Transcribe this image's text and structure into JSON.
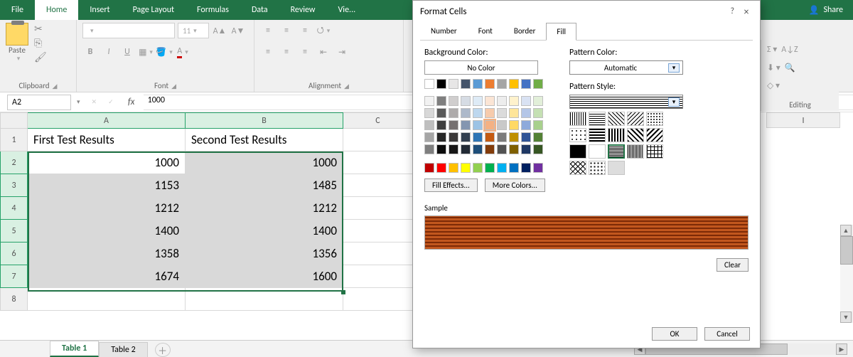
{
  "ribbon_tabs": [
    "File",
    "Home",
    "Insert",
    "Page Layout",
    "Formulas",
    "Data",
    "Review",
    "Vie..."
  ],
  "active_ribbon_tab": "Home",
  "share_label": "Share",
  "clipboard": {
    "group": "Clipboard",
    "paste": "Paste"
  },
  "font": {
    "group": "Font",
    "family": "",
    "size": "11",
    "bold": "B",
    "italic": "I",
    "underline": "U"
  },
  "alignment": {
    "group": "Alignment"
  },
  "editing": {
    "group": "Editing",
    "sort": "A↓Z",
    "find": "🔍"
  },
  "name_box": "A2",
  "formula_value": "1000",
  "columns": [
    "A",
    "B",
    "C"
  ],
  "far_col": "I",
  "rows": [
    1,
    2,
    3,
    4,
    5,
    6,
    7,
    8
  ],
  "headers": {
    "A": "First Test Results",
    "B": "Second Test Results"
  },
  "data_A": [
    1000,
    1153,
    1212,
    1400,
    1358,
    1674
  ],
  "data_B": [
    1000,
    1485,
    1212,
    1400,
    1356,
    1600
  ],
  "sheet_tabs": [
    "Table 1",
    "Table 2"
  ],
  "active_sheet": "Table 1",
  "dialog": {
    "title": "Format Cells",
    "help": "?",
    "close": "×",
    "tabs": [
      "Number",
      "Font",
      "Border",
      "Fill"
    ],
    "active_tab": "Fill",
    "bg_label": "Background Color:",
    "no_color": "No Color",
    "fill_effects": "Fill Effects...",
    "more_colors": "More Colors...",
    "pattern_color_label": "Pattern Color:",
    "pattern_color_value": "Automatic",
    "pattern_style_label": "Pattern Style:",
    "sample": "Sample",
    "clear": "Clear",
    "ok": "OK",
    "cancel": "Cancel",
    "bg_colors_row1": [
      "#ffffff",
      "#000000",
      "#e7e6e6",
      "#44546a",
      "#5b9bd5",
      "#ed7d31",
      "#a5a5a5",
      "#ffc000",
      "#4472c4",
      "#70ad47"
    ],
    "bg_theme_grid": [
      [
        "#f2f2f2",
        "#7f7f7f",
        "#d0cece",
        "#d6dce4",
        "#deebf6",
        "#fbe5d5",
        "#ededed",
        "#fff2cc",
        "#d9e2f3",
        "#e2efd9"
      ],
      [
        "#d8d8d8",
        "#595959",
        "#aeabab",
        "#adb9ca",
        "#bdd7ee",
        "#f7cbac",
        "#dbdbdb",
        "#fee599",
        "#b4c6e7",
        "#c5e0b3"
      ],
      [
        "#bfbfbf",
        "#3f3f3f",
        "#757070",
        "#8496b0",
        "#9cc3e5",
        "#f4b183",
        "#c9c9c9",
        "#ffd965",
        "#8eaadb",
        "#a8d08d"
      ],
      [
        "#a5a5a5",
        "#262626",
        "#3a3838",
        "#323f4f",
        "#2e75b5",
        "#c55a11",
        "#7b7b7b",
        "#bf9000",
        "#2f5496",
        "#538135"
      ],
      [
        "#7f7f7f",
        "#0c0c0c",
        "#171616",
        "#222a35",
        "#1e4e79",
        "#833c0b",
        "#525252",
        "#7f6000",
        "#1f3864",
        "#375623"
      ]
    ],
    "standard_colors": [
      "#c00000",
      "#ff0000",
      "#ffc000",
      "#ffff00",
      "#92d050",
      "#00b050",
      "#00b0f0",
      "#0070c0",
      "#002060",
      "#7030a0"
    ]
  }
}
